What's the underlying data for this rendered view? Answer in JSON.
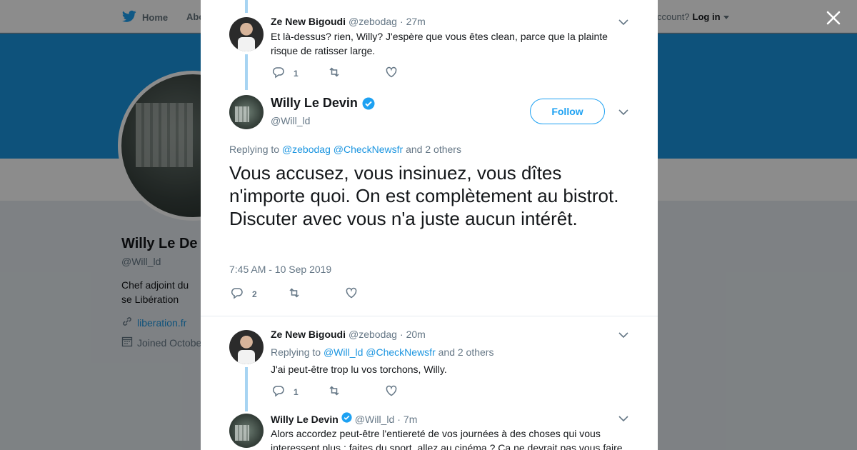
{
  "background": {
    "nav": {
      "home_label": "Home",
      "about_label": "Abo",
      "account_prompt": "ccount?",
      "login_label": "Log in"
    },
    "profile": {
      "name": "Willy Le De",
      "handle": "@Will_ld",
      "bio": "Chef adjoint du se Libération",
      "link": "liberation.fr",
      "joined": "Joined Octobe"
    }
  },
  "tweets": [
    {
      "name": "Ze New Bigoudi",
      "handle": "@zebodag",
      "dot": "·",
      "time": "27m",
      "text": "Et là-dessus? rien, Willy? J'espère que vous êtes clean, parce que la plainte risque de ratisser large.",
      "replies": "1"
    },
    {
      "name": "Ze New Bigoudi",
      "handle": "@zebodag",
      "dot": "·",
      "time": "20m",
      "replying_prefix": "Replying to",
      "replying_mentions": [
        "@Will_ld",
        "@CheckNewsfr"
      ],
      "replying_suffix": "and 2 others",
      "text": "J'ai peut-être trop lu vos torchons, Willy.",
      "replies": "1"
    },
    {
      "name": "Willy Le Devin",
      "handle": "@Will_ld",
      "dot": "·",
      "time": "7m",
      "text": "Alors accordez peut-être l'entiereté de vos journées à des choses qui vous interessent plus ; faites du sport, allez au cinéma ? Ça ne devrait pas vous faire"
    }
  ],
  "main_tweet": {
    "name": "Willy Le Devin",
    "handle": "@Will_ld",
    "follow_label": "Follow",
    "replying_prefix": "Replying to",
    "replying_mentions": [
      "@zebodag",
      "@CheckNewsfr"
    ],
    "replying_suffix": "and 2 others",
    "text": "Vous accusez, vous insinuez, vous dîtes n'importe quoi. On est complètement au bistrot. Discuter avec vous n'a juste aucun intérêt.",
    "timestamp": "7:45 AM - 10 Sep 2019",
    "replies": "2"
  },
  "colors": {
    "accent": "#1da1f2",
    "link": "#1b95e0",
    "banner": "#1b95e0",
    "thread_line": "#a7d4f2",
    "muted": "#657786"
  },
  "icons": [
    "twitter-bird-icon",
    "close-icon",
    "reply-icon",
    "retweet-icon",
    "like-icon",
    "chevron-down-icon",
    "verified-badge-icon",
    "link-icon",
    "calendar-icon"
  ]
}
